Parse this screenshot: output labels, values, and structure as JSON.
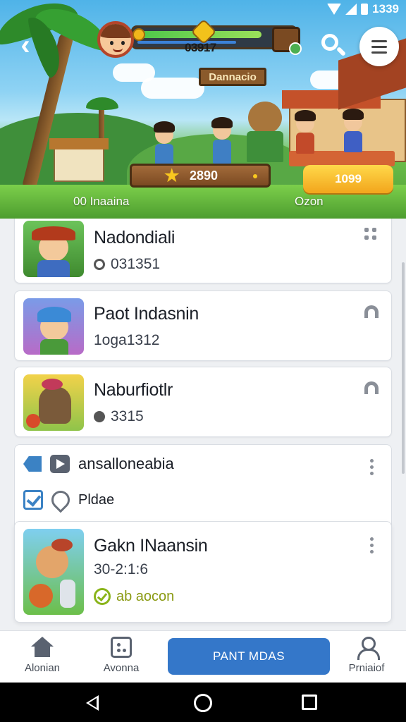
{
  "status_bar": {
    "time": "1339"
  },
  "hero": {
    "xp_value": "03917",
    "shop_sign": "Dannacio",
    "wood_bar_value": "2890",
    "action_button": "1099",
    "caption_left": "00 Inaaina",
    "caption_right": "Ozon"
  },
  "cards": [
    {
      "title": "Nadondiali",
      "sub": "031351",
      "sub_icon": "radio-icon",
      "menu_icon": "grid-icon"
    },
    {
      "title": "Paot Indasnin",
      "sub": "1oga1312",
      "sub_icon": "none",
      "menu_icon": "arch-icon"
    },
    {
      "title": "Naburfiotlr",
      "sub": "3315",
      "sub_icon": "filled-dot-icon",
      "menu_icon": "arch-icon"
    }
  ],
  "group": {
    "row1_label": "ansalloneabia",
    "row2_label": "Pldae",
    "inner": {
      "title": "Gakn INaansin",
      "sub": "30-2:1:6",
      "status": "ab aocon"
    }
  },
  "bottom_nav": {
    "home_label": "Alonian",
    "games_label": "Avonna",
    "primary_button": "PANT MDAS",
    "profile_label": "Prniaiof"
  },
  "colors": {
    "primary": "#3477c9",
    "accent": "#f2a51c",
    "status_ok": "#8ab41a"
  }
}
